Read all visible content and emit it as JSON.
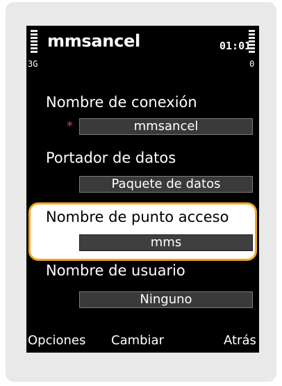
{
  "status": {
    "title": "mmsancel",
    "network": "3G",
    "clock": "01:01",
    "battery_indicator": "0"
  },
  "fields": [
    {
      "label": "Nombre de conexión",
      "value": "mmsancel",
      "required_mark": "*"
    },
    {
      "label": "Portador de datos",
      "value": "Paquete de datos"
    },
    {
      "label": "Nombre de punto acceso",
      "value": "mms"
    },
    {
      "label": "Nombre de usuario",
      "value": "Ninguno"
    }
  ],
  "softkeys": {
    "left": "Opciones",
    "center": "Cambiar",
    "right": "Atrás"
  },
  "colors": {
    "highlight_border": "#f4a61b",
    "required_mark": "#d4348c",
    "screen_background": "#000000"
  }
}
